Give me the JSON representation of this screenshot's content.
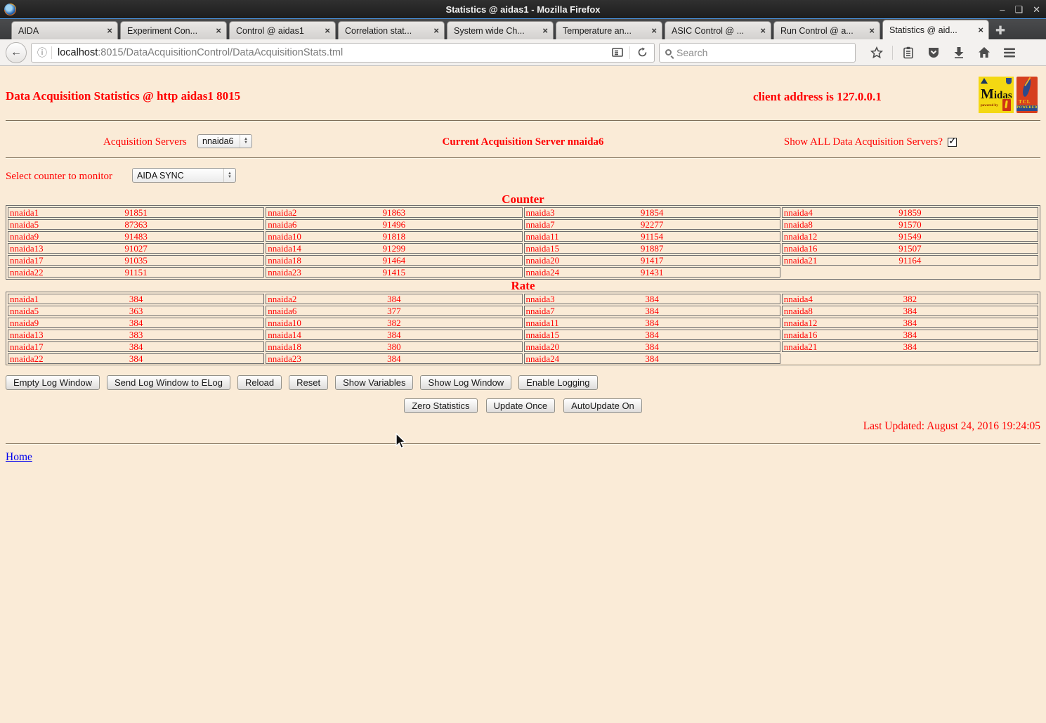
{
  "window": {
    "title": "Statistics @ aidas1 - Mozilla Firefox"
  },
  "tabs": [
    {
      "label": "AIDA",
      "active": false
    },
    {
      "label": "Experiment Con...",
      "active": false
    },
    {
      "label": "Control @ aidas1",
      "active": false
    },
    {
      "label": "Correlation stat...",
      "active": false
    },
    {
      "label": "System wide Ch...",
      "active": false
    },
    {
      "label": "Temperature an...",
      "active": false
    },
    {
      "label": "ASIC Control @ ...",
      "active": false
    },
    {
      "label": "Run Control @ a...",
      "active": false
    },
    {
      "label": "Statistics @ aid...",
      "active": true
    }
  ],
  "toolbar": {
    "url_host": "localhost",
    "url_path": ":8015/DataAcquisitionControl/DataAcquisitionStats.tml",
    "search_placeholder": "Search"
  },
  "page": {
    "title": "Data Acquisition Statistics @ http aidas1 8015",
    "client_address": "client address is 127.0.0.1",
    "acquisition_servers_label": "Acquisition Servers",
    "acquisition_server_selected": "nnaida6",
    "current_server_text": "Current Acquisition Server nnaida6",
    "show_all_label": "Show ALL Data Acquisition Servers?",
    "show_all_checked": true,
    "counter_select_label": "Select counter to monitor",
    "counter_selected": "AIDA SYNC",
    "counter_heading": "Counter",
    "rate_heading": "Rate",
    "counter_rows": [
      [
        {
          "name": "nnaida1",
          "value": "91851"
        },
        {
          "name": "nnaida2",
          "value": "91863"
        },
        {
          "name": "nnaida3",
          "value": "91854"
        },
        {
          "name": "nnaida4",
          "value": "91859"
        }
      ],
      [
        {
          "name": "nnaida5",
          "value": "87363"
        },
        {
          "name": "nnaida6",
          "value": "91496"
        },
        {
          "name": "nnaida7",
          "value": "92277"
        },
        {
          "name": "nnaida8",
          "value": "91570"
        }
      ],
      [
        {
          "name": "nnaida9",
          "value": "91483"
        },
        {
          "name": "nnaida10",
          "value": "91818"
        },
        {
          "name": "nnaida11",
          "value": "91154"
        },
        {
          "name": "nnaida12",
          "value": "91549"
        }
      ],
      [
        {
          "name": "nnaida13",
          "value": "91027"
        },
        {
          "name": "nnaida14",
          "value": "91299"
        },
        {
          "name": "nnaida15",
          "value": "91887"
        },
        {
          "name": "nnaida16",
          "value": "91507"
        }
      ],
      [
        {
          "name": "nnaida17",
          "value": "91035"
        },
        {
          "name": "nnaida18",
          "value": "91464"
        },
        {
          "name": "nnaida20",
          "value": "91417"
        },
        {
          "name": "nnaida21",
          "value": "91164"
        }
      ],
      [
        {
          "name": "nnaida22",
          "value": "91151"
        },
        {
          "name": "nnaida23",
          "value": "91415"
        },
        {
          "name": "nnaida24",
          "value": "91431"
        },
        null
      ]
    ],
    "rate_rows": [
      [
        {
          "name": "nnaida1",
          "value": "384"
        },
        {
          "name": "nnaida2",
          "value": "384"
        },
        {
          "name": "nnaida3",
          "value": "384"
        },
        {
          "name": "nnaida4",
          "value": "382"
        }
      ],
      [
        {
          "name": "nnaida5",
          "value": "363"
        },
        {
          "name": "nnaida6",
          "value": "377"
        },
        {
          "name": "nnaida7",
          "value": "384"
        },
        {
          "name": "nnaida8",
          "value": "384"
        }
      ],
      [
        {
          "name": "nnaida9",
          "value": "384"
        },
        {
          "name": "nnaida10",
          "value": "382"
        },
        {
          "name": "nnaida11",
          "value": "384"
        },
        {
          "name": "nnaida12",
          "value": "384"
        }
      ],
      [
        {
          "name": "nnaida13",
          "value": "383"
        },
        {
          "name": "nnaida14",
          "value": "384"
        },
        {
          "name": "nnaida15",
          "value": "384"
        },
        {
          "name": "nnaida16",
          "value": "384"
        }
      ],
      [
        {
          "name": "nnaida17",
          "value": "384"
        },
        {
          "name": "nnaida18",
          "value": "380"
        },
        {
          "name": "nnaida20",
          "value": "384"
        },
        {
          "name": "nnaida21",
          "value": "384"
        }
      ],
      [
        {
          "name": "nnaida22",
          "value": "384"
        },
        {
          "name": "nnaida23",
          "value": "384"
        },
        {
          "name": "nnaida24",
          "value": "384"
        },
        null
      ]
    ],
    "buttons_row1": [
      "Empty Log Window",
      "Send Log Window to ELog",
      "Reload",
      "Reset",
      "Show Variables",
      "Show Log Window",
      "Enable Logging"
    ],
    "buttons_row2": [
      "Zero Statistics",
      "Update Once",
      "AutoUpdate On"
    ],
    "last_updated": "Last Updated: August 24, 2016 19:24:05",
    "home_link": "Home"
  },
  "logos": {
    "midas_text": "Midas",
    "midas_powered": "powered by",
    "tcl_text": "TCL",
    "tcl_powered": "POWERED"
  },
  "colors": {
    "page_background": "#faebd7",
    "page_text": "#ff0000",
    "link": "#0000ee",
    "titlebar_accent": "#4a90d9"
  }
}
